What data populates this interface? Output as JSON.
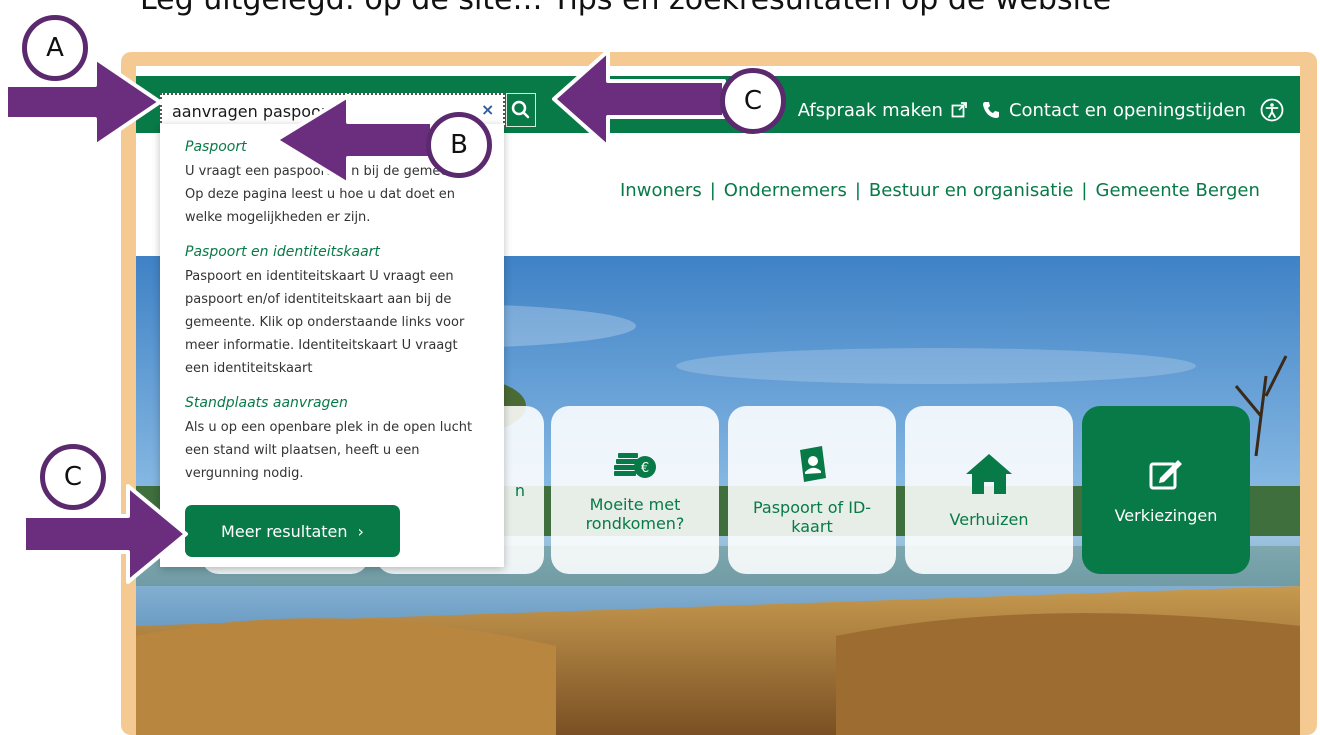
{
  "caption": {
    "text": "Leg uitgelegd: op de site… Tips en zoekresultaten op de website"
  },
  "search": {
    "value": "aanvragen paspoort",
    "clear_label": "×"
  },
  "toplinks": {
    "appointment": "Afspraak maken",
    "contact": "Contact en openingstijden"
  },
  "nav": {
    "items": [
      "Inwoners",
      "Ondernemers",
      "Bestuur en organisatie",
      "Gemeente Bergen"
    ],
    "separator": "|"
  },
  "dropdown": {
    "results": [
      {
        "title": "Paspoort",
        "text": "U vraagt een paspoort aan bij de gemeente. Op deze pagina leest u hoe u dat doet en welke mogelijkheden er zijn."
      },
      {
        "title": "Paspoort en identiteitskaart",
        "text": "Paspoort en identiteitskaart U vraagt een paspoort en/of identiteitskaart aan bij de gemeente. Klik op onderstaande links voor meer informatie. Identiteitskaart U vraagt een identiteitskaart"
      },
      {
        "title": "Standplaats aanvragen",
        "text": "Als u op een openbare plek in de open lucht een stand wilt plaatsen, heeft u een vergunning nodig."
      }
    ],
    "more_button": "Meer resultaten",
    "more_chevron": "›"
  },
  "tiles": [
    {
      "label": "",
      "icon": "unknown-icon"
    },
    {
      "label": "n",
      "icon": "unknown-icon"
    },
    {
      "label": "Moeite met rondkomen?",
      "icon": "coins-euro-icon"
    },
    {
      "label": "Paspoort of ID-kaart",
      "icon": "passport-icon"
    },
    {
      "label": "Verhuizen",
      "icon": "house-icon"
    },
    {
      "label": "Verkiezingen",
      "icon": "ballot-pen-icon"
    }
  ],
  "callouts": {
    "a": "A",
    "b": "B",
    "c_top": "C",
    "c_bottom": "C"
  },
  "colors": {
    "brand_green": "#087a47",
    "frame": "#f5c992",
    "annotation_purple": "#6b2d7d"
  }
}
